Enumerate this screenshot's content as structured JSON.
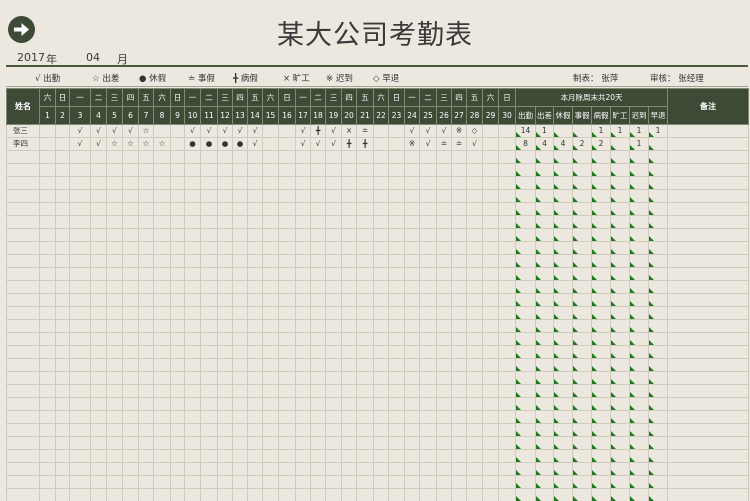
{
  "title": "某大公司考勤表",
  "year": "2017",
  "year_unit": "年",
  "month": "04",
  "month_unit": "月",
  "legend": [
    {
      "symbol": "√",
      "label": "出勤"
    },
    {
      "symbol": "☆",
      "label": "出差"
    },
    {
      "symbol": "●",
      "label": "休假"
    },
    {
      "symbol": "≐",
      "label": "事假"
    },
    {
      "symbol": "╋",
      "label": "病假"
    },
    {
      "symbol": "×",
      "label": "旷工"
    },
    {
      "symbol": "※",
      "label": "迟到"
    },
    {
      "symbol": "◇",
      "label": "早退"
    }
  ],
  "maker_label": "制表：",
  "maker": "张萍",
  "reviewer_label": "审核：",
  "reviewer": "张经理",
  "headers": {
    "name": "姓名",
    "summary": "本月除周末共20天",
    "remark": "备注",
    "summary_cols": [
      "出勤",
      "出差",
      "休假",
      "事假",
      "病假",
      "旷工",
      "迟到",
      "早退"
    ]
  },
  "weekdays": [
    "六",
    "日",
    "一",
    "二",
    "三",
    "四",
    "五",
    "六",
    "日",
    "一",
    "二",
    "三",
    "四",
    "五",
    "六",
    "日",
    "一",
    "二",
    "三",
    "四",
    "五",
    "六",
    "日",
    "一",
    "二",
    "三",
    "四",
    "五",
    "六",
    "日"
  ],
  "days": [
    "1",
    "2",
    "3",
    "4",
    "5",
    "6",
    "7",
    "8",
    "9",
    "10",
    "11",
    "12",
    "13",
    "14",
    "15",
    "16",
    "17",
    "18",
    "19",
    "20",
    "21",
    "22",
    "23",
    "24",
    "25",
    "26",
    "27",
    "28",
    "29",
    "30"
  ],
  "employees": [
    {
      "name": "张三",
      "marks": [
        "",
        "",
        "√",
        "√",
        "√",
        "√",
        "☆",
        "",
        "",
        "√",
        "√",
        "√",
        "√",
        "√",
        "",
        "",
        "√",
        "╋",
        "√",
        "×",
        "≐",
        "",
        "",
        "√",
        "√",
        "√",
        "※",
        "◇",
        "",
        ""
      ],
      "summary": [
        "14",
        "1",
        "",
        "",
        "1",
        "1",
        "1",
        "1"
      ]
    },
    {
      "name": "李四",
      "marks": [
        "",
        "",
        "√",
        "√",
        "☆",
        "☆",
        "☆",
        "☆",
        "",
        "●",
        "●",
        "●",
        "●",
        "√",
        "",
        "",
        "√",
        "√",
        "√",
        "╋",
        "╋",
        "",
        "",
        "※",
        "√",
        "≐",
        "≐",
        "√",
        "",
        ""
      ],
      "summary": [
        "8",
        "4",
        "4",
        "2",
        "2",
        "",
        "1",
        ""
      ]
    }
  ],
  "empty_rows": 28
}
